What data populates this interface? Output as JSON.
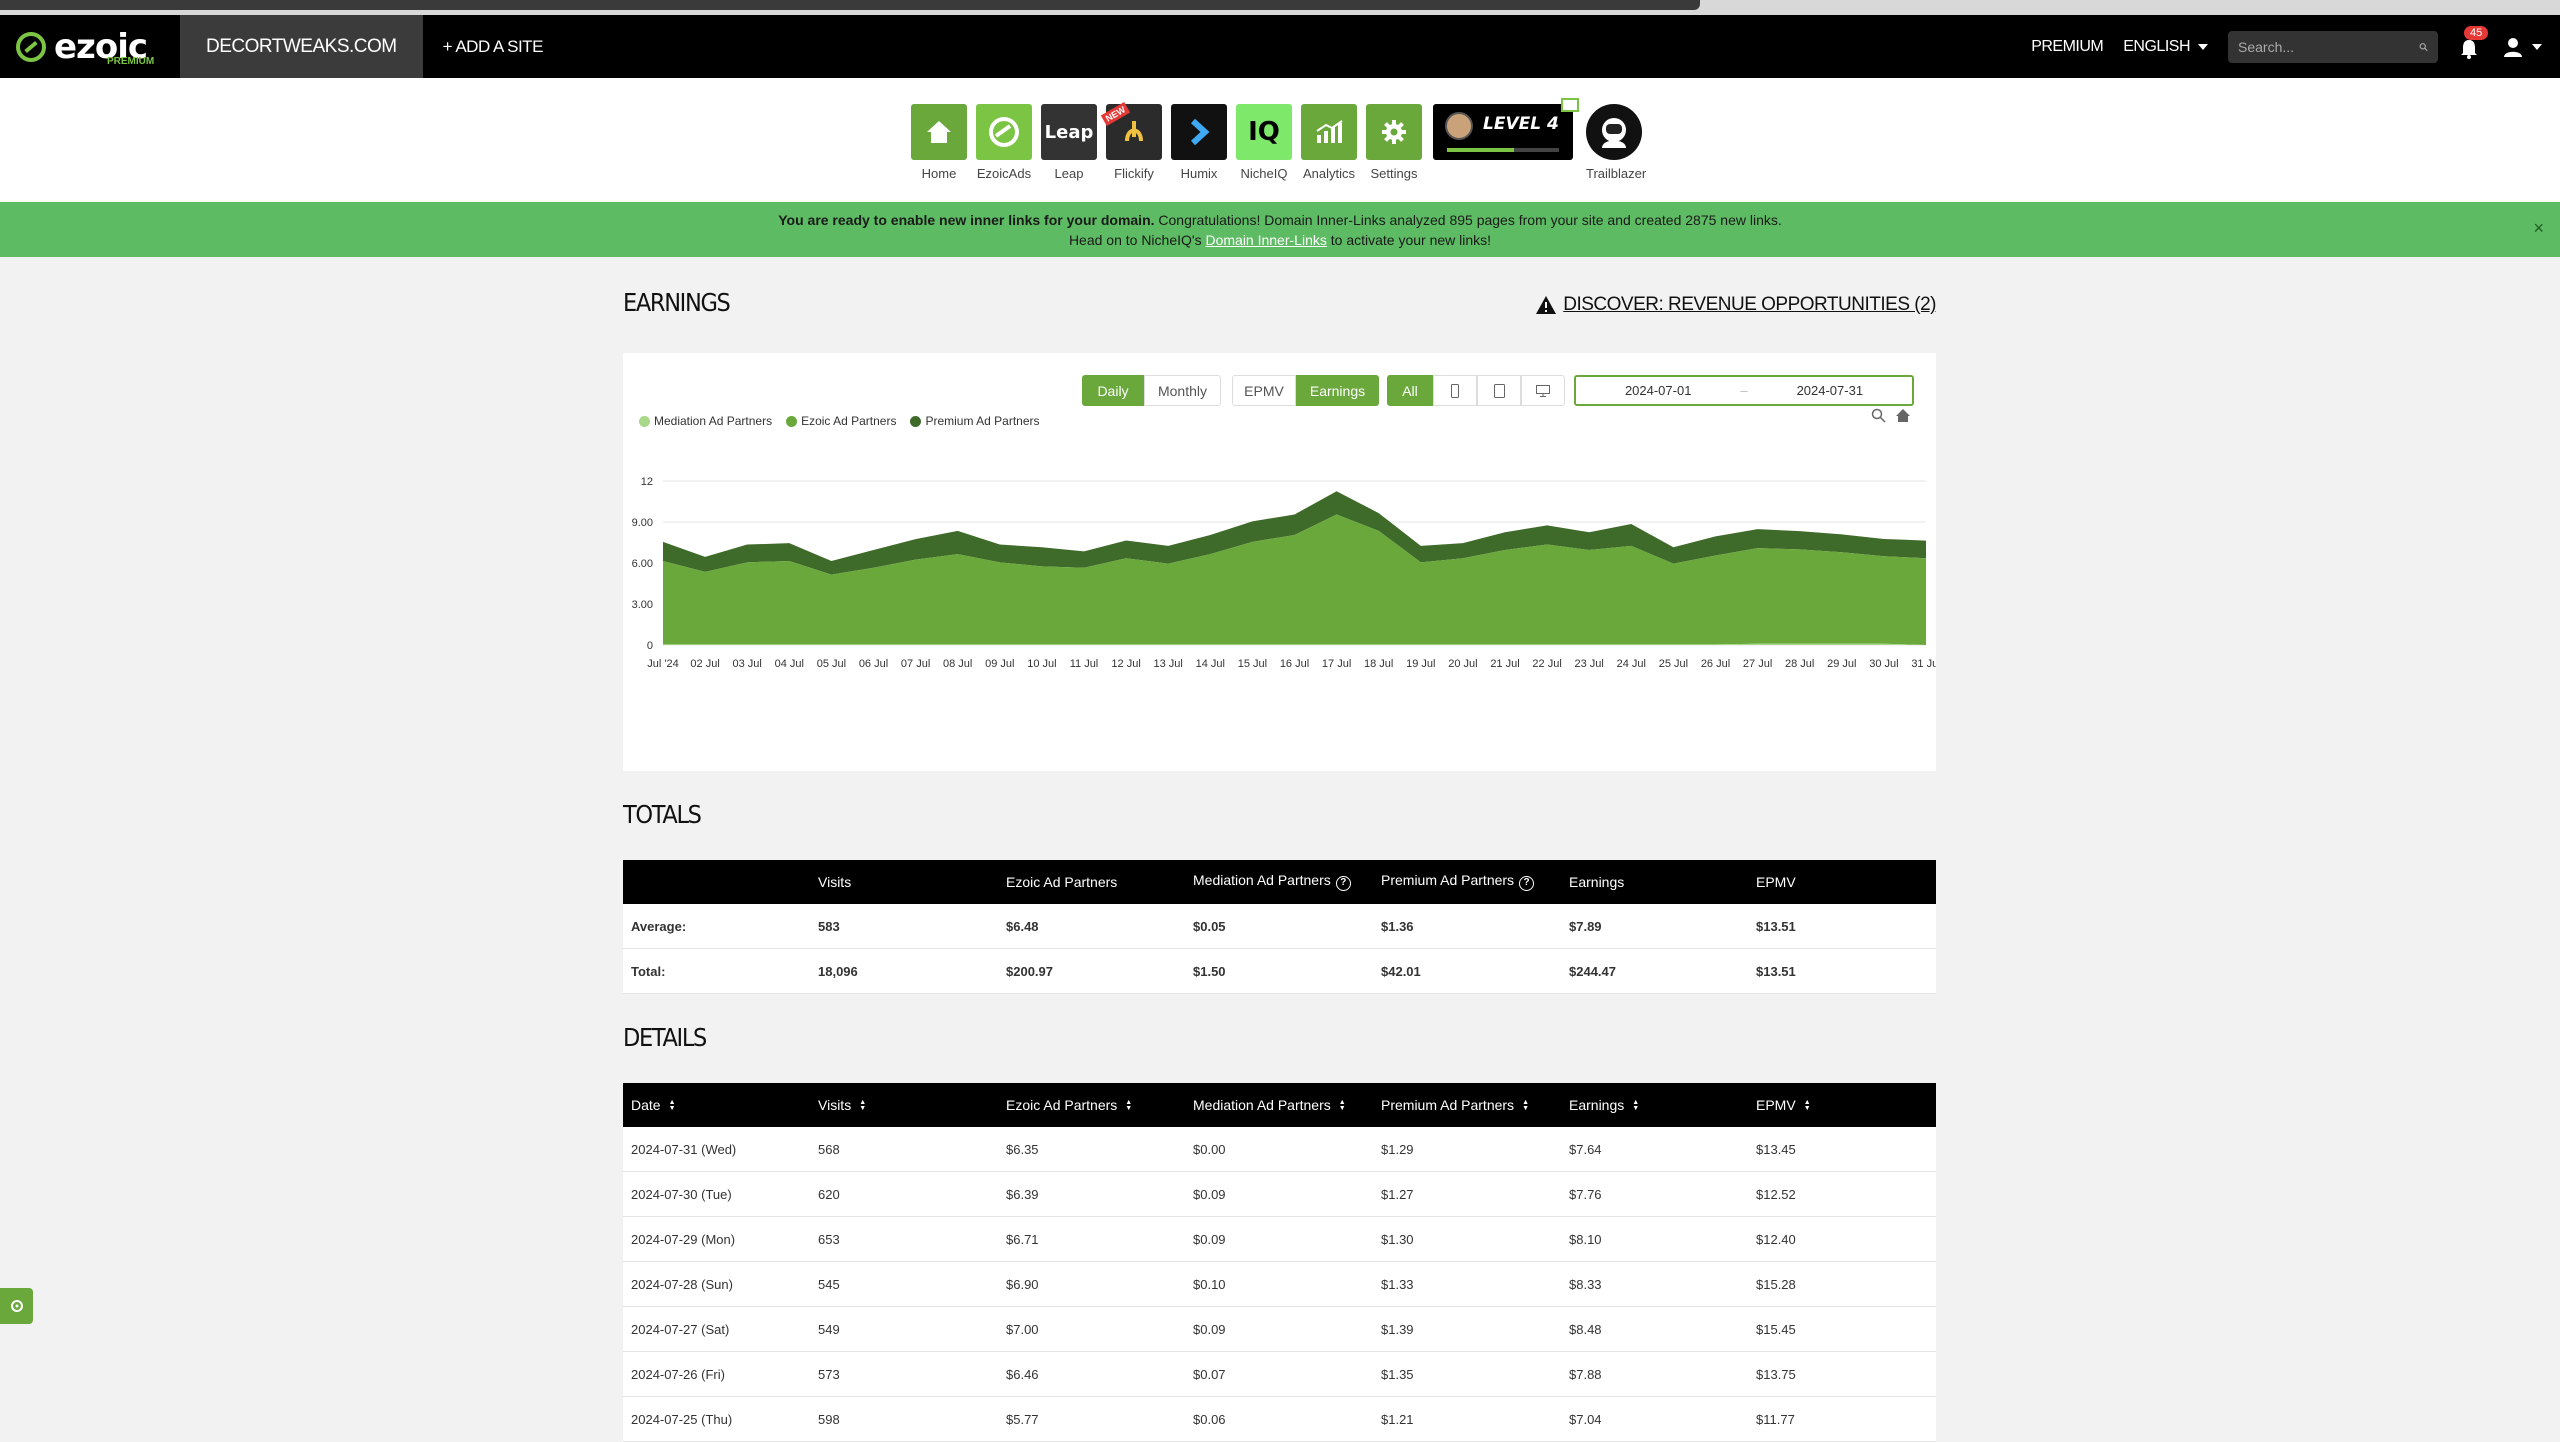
{
  "navbar": {
    "logo_text": "ezoic",
    "logo_sub": "PREMIUM",
    "site": "DECORTWEAKS.COM",
    "add_site": "+ ADD A SITE",
    "premium": "PREMIUM",
    "language": "ENGLISH",
    "search_placeholder": "Search...",
    "notifications_count": "45"
  },
  "apps": [
    {
      "label": "Home",
      "icon": "home-icon",
      "color": "#6aa83c"
    },
    {
      "label": "EzoicAds",
      "icon": "ezoic-ads-icon",
      "color": "#7cc544"
    },
    {
      "label": "Leap",
      "icon": "leap-icon",
      "color": "#333333"
    },
    {
      "label": "Flickify",
      "icon": "flickify-icon",
      "color": "#2b2b2b"
    },
    {
      "label": "Humix",
      "icon": "humix-icon",
      "color": "#111111"
    },
    {
      "label": "NicheIQ",
      "icon": "nicheiq-icon",
      "color": "#7ee86a"
    },
    {
      "label": "Analytics",
      "icon": "analytics-icon",
      "color": "#6aa83c"
    },
    {
      "label": "Settings",
      "icon": "settings-icon",
      "color": "#6aa83c"
    }
  ],
  "app_texts": {
    "leap": "Leap",
    "new_badge": "NEW",
    "iq": "IQ"
  },
  "level": {
    "text": "LEVEL 4",
    "progress": 0.6
  },
  "trailblazer": {
    "label": "Trailblazer"
  },
  "banner": {
    "bold": "You are ready to enable new inner links for your domain.",
    "text": " Congratulations! Domain Inner-Links analyzed 895 pages from your site and created 2875 new links.",
    "line2_pre": "Head on to NicheIQ's ",
    "line2_link": "Domain Inner-Links",
    "line2_post": " to activate your new links!",
    "close": "×"
  },
  "earnings": {
    "title": "EARNINGS",
    "discover": "DISCOVER: REVENUE OPPORTUNITIES (2)",
    "controls": {
      "daily": "Daily",
      "monthly": "Monthly",
      "epmv": "EPMV",
      "earnings": "Earnings",
      "all": "All",
      "date_from": "2024-07-01",
      "date_sep": "–",
      "date_to": "2024-07-31"
    }
  },
  "chart_data": {
    "type": "area",
    "stacked": true,
    "x": [
      "Jul '24",
      "02 Jul",
      "03 Jul",
      "04 Jul",
      "05 Jul",
      "06 Jul",
      "07 Jul",
      "08 Jul",
      "09 Jul",
      "10 Jul",
      "11 Jul",
      "12 Jul",
      "13 Jul",
      "14 Jul",
      "15 Jul",
      "16 Jul",
      "17 Jul",
      "18 Jul",
      "19 Jul",
      "20 Jul",
      "21 Jul",
      "22 Jul",
      "23 Jul",
      "24 Jul",
      "25 Jul",
      "26 Jul",
      "27 Jul",
      "28 Jul",
      "29 Jul",
      "30 Jul",
      "31 Jul"
    ],
    "series": [
      {
        "name": "Mediation Ad Partners",
        "color": "#a8d98a",
        "values": [
          0.05,
          0.05,
          0.05,
          0.05,
          0.05,
          0.05,
          0.05,
          0.05,
          0.05,
          0.05,
          0.05,
          0.05,
          0.05,
          0.05,
          0.05,
          0.05,
          0.05,
          0.05,
          0.05,
          0.05,
          0.05,
          0.05,
          0.05,
          0.05,
          0.05,
          0.05,
          0.09,
          0.1,
          0.09,
          0.09,
          0.0
        ]
      },
      {
        "name": "Ezoic Ad Partners",
        "color": "#6aa83c",
        "values": [
          6.1,
          5.3,
          6.0,
          6.1,
          5.1,
          5.6,
          6.2,
          6.6,
          6.0,
          5.7,
          5.6,
          6.3,
          5.9,
          6.6,
          7.5,
          8.0,
          9.5,
          8.3,
          6.0,
          6.3,
          6.9,
          7.3,
          6.9,
          7.2,
          5.9,
          6.5,
          7.0,
          6.9,
          6.7,
          6.4,
          6.35
        ]
      },
      {
        "name": "Premium Ad Partners",
        "color": "#3f6b2a",
        "values": [
          1.4,
          1.1,
          1.3,
          1.3,
          1.0,
          1.3,
          1.5,
          1.7,
          1.3,
          1.4,
          1.2,
          1.3,
          1.3,
          1.4,
          1.5,
          1.5,
          1.7,
          1.3,
          1.2,
          1.1,
          1.3,
          1.4,
          1.3,
          1.6,
          1.2,
          1.4,
          1.39,
          1.33,
          1.3,
          1.27,
          1.29
        ]
      }
    ],
    "yticks": [
      "0",
      "3.00",
      "6.00",
      "9.00",
      "12"
    ],
    "ylim": [
      0,
      12
    ],
    "legend_position": "top-left"
  },
  "totals": {
    "title": "TOTALS",
    "headers": [
      "",
      "Visits",
      "Ezoic Ad Partners",
      "Mediation Ad Partners",
      "Premium Ad Partners",
      "Earnings",
      "EPMV"
    ],
    "rows": [
      [
        "Average:",
        "583",
        "$6.48",
        "$0.05",
        "$1.36",
        "$7.89",
        "$13.51"
      ],
      [
        "Total:",
        "18,096",
        "$200.97",
        "$1.50",
        "$42.01",
        "$244.47",
        "$13.51"
      ]
    ]
  },
  "details": {
    "title": "DETAILS",
    "headers": [
      "Date",
      "Visits",
      "Ezoic Ad Partners",
      "Mediation Ad Partners",
      "Premium Ad Partners",
      "Earnings",
      "EPMV"
    ],
    "rows": [
      [
        "2024-07-31 (Wed)",
        "568",
        "$6.35",
        "$0.00",
        "$1.29",
        "$7.64",
        "$13.45"
      ],
      [
        "2024-07-30 (Tue)",
        "620",
        "$6.39",
        "$0.09",
        "$1.27",
        "$7.76",
        "$12.52"
      ],
      [
        "2024-07-29 (Mon)",
        "653",
        "$6.71",
        "$0.09",
        "$1.30",
        "$8.10",
        "$12.40"
      ],
      [
        "2024-07-28 (Sun)",
        "545",
        "$6.90",
        "$0.10",
        "$1.33",
        "$8.33",
        "$15.28"
      ],
      [
        "2024-07-27 (Sat)",
        "549",
        "$7.00",
        "$0.09",
        "$1.39",
        "$8.48",
        "$15.45"
      ],
      [
        "2024-07-26 (Fri)",
        "573",
        "$6.46",
        "$0.07",
        "$1.35",
        "$7.88",
        "$13.75"
      ],
      [
        "2024-07-25 (Thu)",
        "598",
        "$5.77",
        "$0.06",
        "$1.21",
        "$7.04",
        "$11.77"
      ]
    ]
  }
}
